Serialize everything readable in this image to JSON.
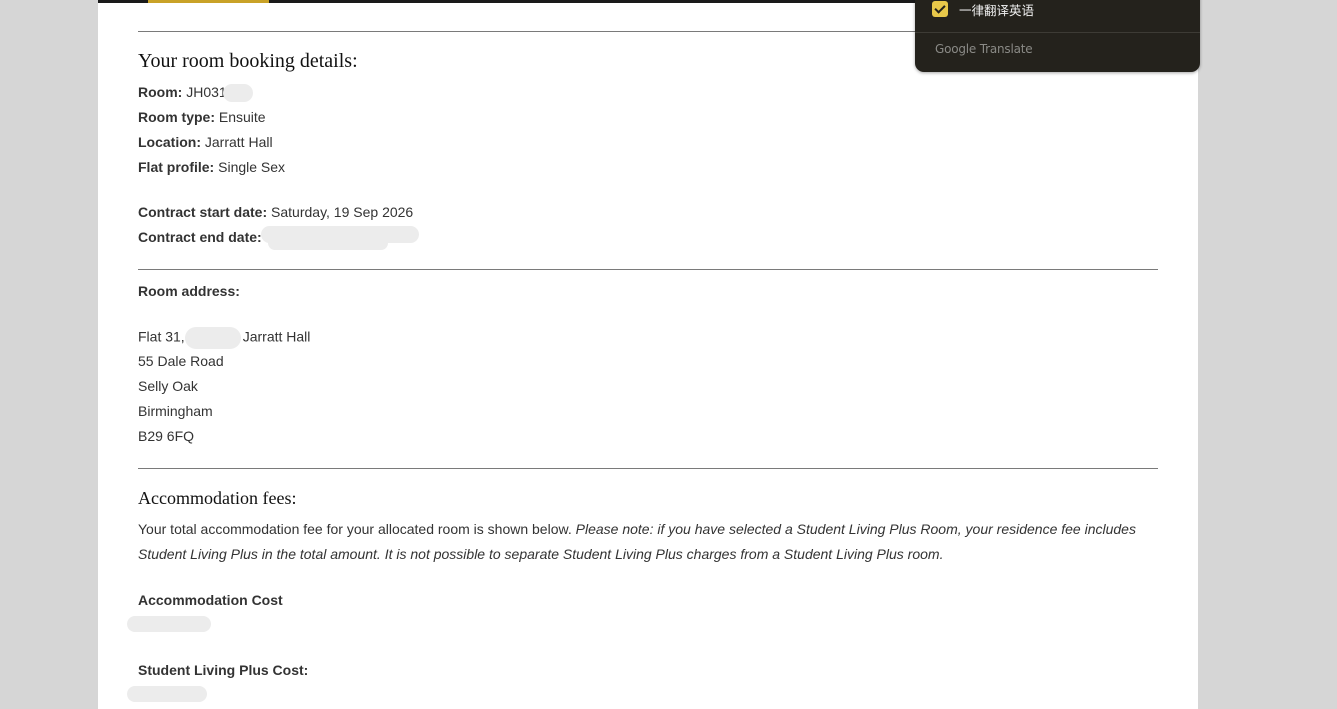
{
  "booking": {
    "heading": "Your room booking details:",
    "room_label": "Room:",
    "room_value": "JH031",
    "room_type_label": "Room type:",
    "room_type_value": "Ensuite",
    "location_label": "Location:",
    "location_value": "Jarratt Hall",
    "flat_profile_label": "Flat profile:",
    "flat_profile_value": "Single Sex",
    "contract_start_label": "Contract start date:",
    "contract_start_value": "Saturday, 19 Sep 2026",
    "contract_end_label": "Contract end date:"
  },
  "address": {
    "label": "Room address:",
    "line1_prefix": "Flat 31,",
    "line1_suffix": "Jarratt Hall",
    "line2": "55 Dale Road",
    "line3": "Selly Oak",
    "line4": "Birmingham",
    "line5": "B29 6FQ"
  },
  "fees": {
    "heading": "Accommodation fees:",
    "intro_plain": "Your total accommodation fee for your allocated room is shown below.",
    "intro_italic": "Please note: if you have selected a Student Living Plus Room, your residence fee includes Student Living Plus in the total amount. It is not possible to separate Student Living Plus charges from a Student Living Plus room.",
    "accommodation_cost_label": "Accommodation Cost",
    "student_living_plus_label": "Student Living Plus Cost:"
  },
  "translate_popup": {
    "checkbox_label": "一律翻译英语",
    "checkbox_checked": true,
    "brand": "Google Translate",
    "accent_color": "#e8c84a",
    "background_color": "#24221c"
  }
}
